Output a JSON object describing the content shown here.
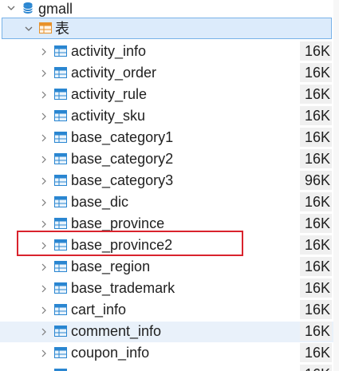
{
  "database": {
    "name": "gmall"
  },
  "folder": {
    "name": "表"
  },
  "tables": [
    {
      "name": "activity_info",
      "size": "16K"
    },
    {
      "name": "activity_order",
      "size": "16K"
    },
    {
      "name": "activity_rule",
      "size": "16K"
    },
    {
      "name": "activity_sku",
      "size": "16K"
    },
    {
      "name": "base_category1",
      "size": "16K"
    },
    {
      "name": "base_category2",
      "size": "16K"
    },
    {
      "name": "base_category3",
      "size": "96K"
    },
    {
      "name": "base_dic",
      "size": "16K"
    },
    {
      "name": "base_province",
      "size": "16K"
    },
    {
      "name": "base_province2",
      "size": "16K"
    },
    {
      "name": "base_region",
      "size": "16K"
    },
    {
      "name": "base_trademark",
      "size": "16K"
    },
    {
      "name": "cart_info",
      "size": "16K"
    },
    {
      "name": "comment_info",
      "size": "16K"
    },
    {
      "name": "coupon_info",
      "size": "16K"
    },
    {
      "name": "",
      "size": "16K"
    }
  ],
  "colors": {
    "selection_bg": "#dcebfb",
    "selection_border": "#78b2e8",
    "hover_bg": "#e9f1fa",
    "highlight_border": "#d9232d",
    "table_icon": "#2a86d1",
    "db_icon": "#2a86d1",
    "folder_icon": "#e8922a"
  },
  "icons": {
    "database": "database-icon",
    "folder": "table-folder-icon",
    "table": "table-icon",
    "expanded": "chevron-down-icon",
    "collapsed": "chevron-right-icon"
  },
  "highlighted_table": "base_province2",
  "hovered_table": "comment_info"
}
